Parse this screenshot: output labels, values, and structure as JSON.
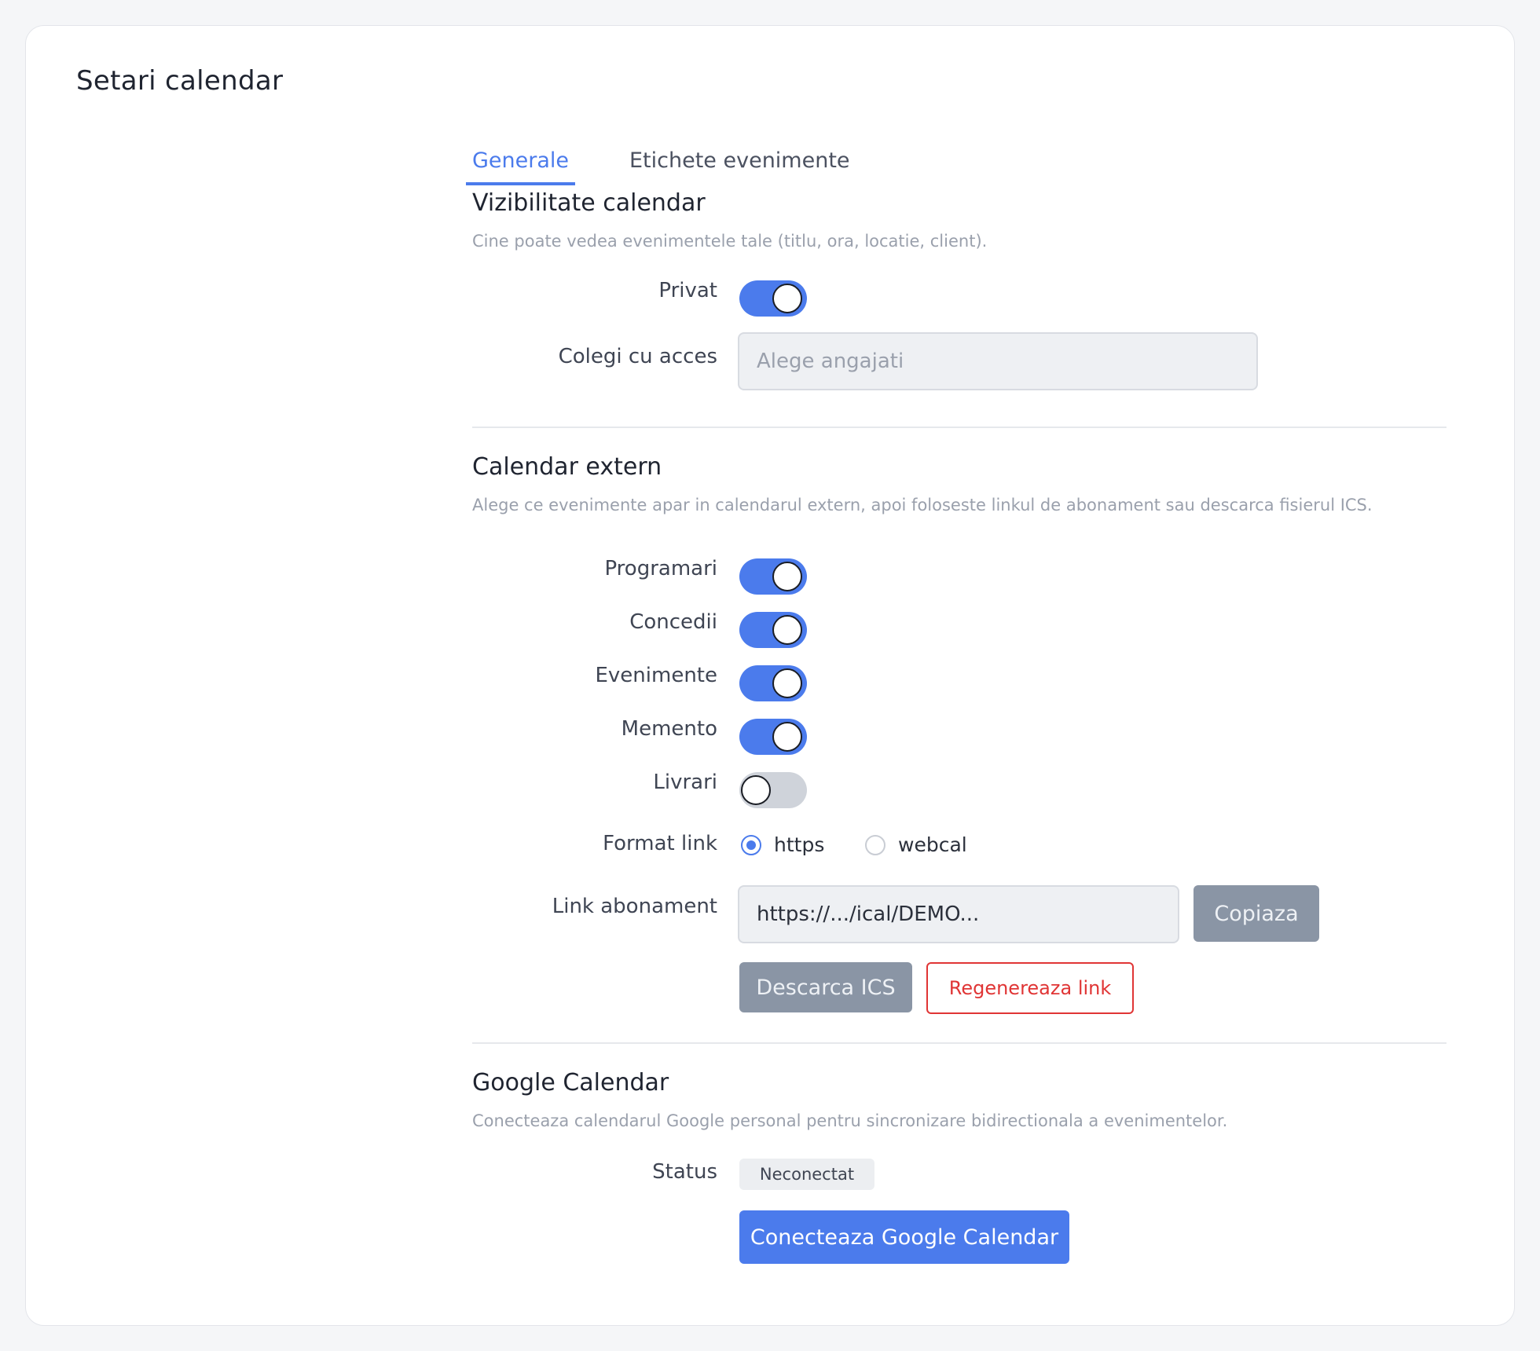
{
  "page": {
    "title": "Setari calendar"
  },
  "tabs": [
    {
      "label": "Generale",
      "active": true
    },
    {
      "label": "Etichete evenimente",
      "active": false
    }
  ],
  "visibility": {
    "title": "Vizibilitate calendar",
    "description": "Cine poate vedea evenimentele tale (titlu, ora, locatie, client).",
    "private_label": "Privat",
    "private_on": true,
    "colleagues_label": "Colegi cu acces",
    "colleagues_placeholder": "Alege angajati"
  },
  "external": {
    "title": "Calendar extern",
    "description": "Alege ce evenimente apar in calendarul extern, apoi foloseste linkul de abonament sau descarca fisierul ICS.",
    "toggles": [
      {
        "label": "Programari",
        "on": true
      },
      {
        "label": "Concedii",
        "on": true
      },
      {
        "label": "Evenimente",
        "on": true
      },
      {
        "label": "Memento",
        "on": true
      },
      {
        "label": "Livrari",
        "on": false
      }
    ],
    "format_label": "Format link",
    "format_options": [
      {
        "label": "https",
        "checked": true
      },
      {
        "label": "webcal",
        "checked": false
      }
    ],
    "link_label": "Link abonament",
    "link_value": "https://.../ical/DEMO...",
    "copy_button": "Copiaza",
    "download_button": "Descarca ICS",
    "regenerate_button": "Regenereaza link"
  },
  "google": {
    "title": "Google Calendar",
    "description": "Conecteaza calendarul Google personal pentru sincronizare bidirectionala a evenimentelor.",
    "status_label": "Status",
    "status_value": "Neconectat",
    "connect_button": "Conecteaza Google Calendar"
  },
  "colors": {
    "accent": "#4b7bec",
    "danger": "#e03535",
    "muted_button": "#8a95a5",
    "toggle_off": "#cfd3da"
  }
}
